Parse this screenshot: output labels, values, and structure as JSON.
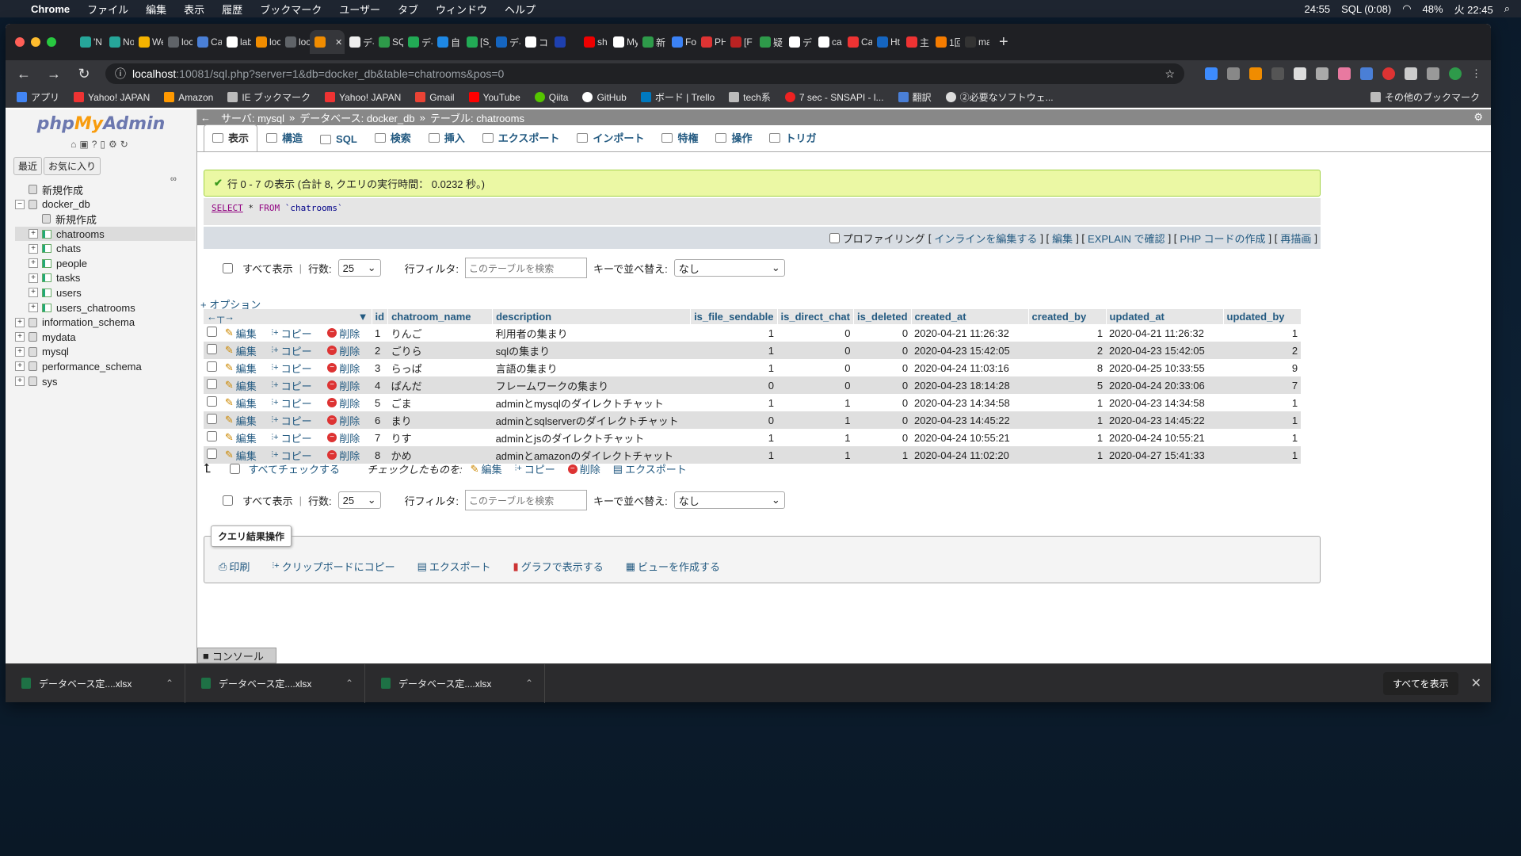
{
  "menubar": {
    "app": "Chrome",
    "items": [
      "ファイル",
      "編集",
      "表示",
      "履歴",
      "ブックマーク",
      "ユーザー",
      "タブ",
      "ウィンドウ",
      "ヘルプ"
    ],
    "status": {
      "timer": "24:55",
      "sql": "SQL (0:08)",
      "battery": "48%",
      "clock": "火 22:45"
    }
  },
  "tabs": [
    "'N",
    "No",
    "We",
    "loc",
    "Ca",
    "lab",
    "loc",
    "loc",
    "",
    "デ-",
    "SQ",
    "デ-",
    "自",
    "[S_",
    "デ-",
    "コ",
    "",
    "sh",
    "My",
    "新",
    "Fo",
    "PH",
    "[F",
    "疑",
    "デ",
    "ca",
    "Ca",
    "Ht",
    "主",
    "1回",
    "ma"
  ],
  "address": {
    "host": "localhost",
    "path": ":10081/sql.php?server=1&db=docker_db&table=chatrooms&pos=0"
  },
  "bookmarks": [
    "アプリ",
    "Yahoo! JAPAN",
    "Amazon",
    "IE ブックマーク",
    "Yahoo! JAPAN",
    "Gmail",
    "YouTube",
    "Qiita",
    "GitHub",
    "ボード | Trello",
    "tech系",
    "7 sec - SNSAPI - l...",
    "翻訳",
    "②必要なソフトウェ..."
  ],
  "bookmarks_other": "その他のブックマーク",
  "sidebar": {
    "logo_php": "php",
    "logo_my": "My",
    "logo_admin": "Admin",
    "recent": "最近",
    "favorites": "お気に入り",
    "tree": [
      {
        "label": "新規作成",
        "level": 0,
        "type": "new"
      },
      {
        "label": "docker_db",
        "level": 0,
        "type": "db",
        "exp": "−"
      },
      {
        "label": "新規作成",
        "level": 1,
        "type": "new"
      },
      {
        "label": "chatrooms",
        "level": 1,
        "type": "table",
        "exp": "+",
        "selected": true
      },
      {
        "label": "chats",
        "level": 1,
        "type": "table",
        "exp": "+"
      },
      {
        "label": "people",
        "level": 1,
        "type": "table",
        "exp": "+"
      },
      {
        "label": "tasks",
        "level": 1,
        "type": "table",
        "exp": "+"
      },
      {
        "label": "users",
        "level": 1,
        "type": "table",
        "exp": "+"
      },
      {
        "label": "users_chatrooms",
        "level": 1,
        "type": "table",
        "exp": "+"
      },
      {
        "label": "information_schema",
        "level": 0,
        "type": "db",
        "exp": "+"
      },
      {
        "label": "mydata",
        "level": 0,
        "type": "db",
        "exp": "+"
      },
      {
        "label": "mysql",
        "level": 0,
        "type": "db",
        "exp": "+"
      },
      {
        "label": "performance_schema",
        "level": 0,
        "type": "db",
        "exp": "+"
      },
      {
        "label": "sys",
        "level": 0,
        "type": "db",
        "exp": "+"
      }
    ]
  },
  "breadcrumb": {
    "server": "サーバ: mysql",
    "sep": "»",
    "database": "データベース: docker_db",
    "table": "テーブル: chatrooms"
  },
  "maintabs": [
    "表示",
    "構造",
    "SQL",
    "検索",
    "挿入",
    "エクスポート",
    "インポート",
    "特権",
    "操作",
    "トリガ"
  ],
  "success_message": "行 0 - 7 の表示 (合計 8, クエリの実行時間： 0.0232 秒。)",
  "sql": {
    "select": "SELECT",
    "star": " * ",
    "from": "FROM",
    "table": " `chatrooms`"
  },
  "profile": {
    "label": "プロファイリング",
    "links": [
      "インラインを編集する",
      "編集",
      "EXPLAIN で確認",
      "PHP コードの作成",
      "再描画"
    ]
  },
  "nav": {
    "show_all": "すべて表示",
    "rows_label": "行数:",
    "rows_value": "25",
    "filter_label": "行フィルタ:",
    "filter_placeholder": "このテーブルを検索",
    "sort_label": "キーで並べ替え:",
    "sort_value": "なし"
  },
  "options_link": "+ オプション",
  "actions": {
    "edit": "編集",
    "copy": "コピー",
    "delete": "削除"
  },
  "columns": [
    "id",
    "chatroom_name",
    "description",
    "is_file_sendable",
    "is_direct_chat",
    "is_deleted",
    "created_at",
    "created_by",
    "updated_at",
    "updated_by"
  ],
  "rows": [
    [
      "1",
      "りんご",
      "利用者の集まり",
      "1",
      "0",
      "0",
      "2020-04-21 11:26:32",
      "1",
      "2020-04-21 11:26:32",
      "1"
    ],
    [
      "2",
      "ごりら",
      "sqlの集まり",
      "1",
      "0",
      "0",
      "2020-04-23 15:42:05",
      "2",
      "2020-04-23 15:42:05",
      "2"
    ],
    [
      "3",
      "らっぱ",
      "言語の集まり",
      "1",
      "0",
      "0",
      "2020-04-24 11:03:16",
      "8",
      "2020-04-25 10:33:55",
      "9"
    ],
    [
      "4",
      "ぱんだ",
      "フレームワークの集まり",
      "0",
      "0",
      "0",
      "2020-04-23 18:14:28",
      "5",
      "2020-04-24 20:33:06",
      "7"
    ],
    [
      "5",
      "ごま",
      "adminとmysqlのダイレクトチャット",
      "1",
      "1",
      "0",
      "2020-04-23 14:34:58",
      "1",
      "2020-04-23 14:34:58",
      "1"
    ],
    [
      "6",
      "まり",
      "adminとsqlserverのダイレクトチャット",
      "0",
      "1",
      "0",
      "2020-04-23 14:45:22",
      "1",
      "2020-04-23 14:45:22",
      "1"
    ],
    [
      "7",
      "りす",
      "adminとjsのダイレクトチャット",
      "1",
      "1",
      "0",
      "2020-04-24 10:55:21",
      "1",
      "2020-04-24 10:55:21",
      "1"
    ],
    [
      "8",
      "かめ",
      "adminとamazonのダイレクトチャット",
      "1",
      "1",
      "1",
      "2020-04-24 11:02:20",
      "1",
      "2020-04-27 15:41:33",
      "1"
    ]
  ],
  "bulk": {
    "check_all": "すべてチェックする",
    "with_selected": "チェックしたものを:",
    "edit": "編集",
    "copy": "コピー",
    "delete": "削除",
    "export": "エクスポート"
  },
  "query_ops": {
    "title": "クエリ結果操作",
    "items": [
      "印刷",
      "クリップボードにコピー",
      "エクスポート",
      "グラフで表示する",
      "ビューを作成する"
    ]
  },
  "console": "コンソール",
  "downloads": {
    "items": [
      "データベース定....xlsx",
      "データベース定....xlsx",
      "データベース定....xlsx"
    ],
    "show_all": "すべてを表示"
  }
}
